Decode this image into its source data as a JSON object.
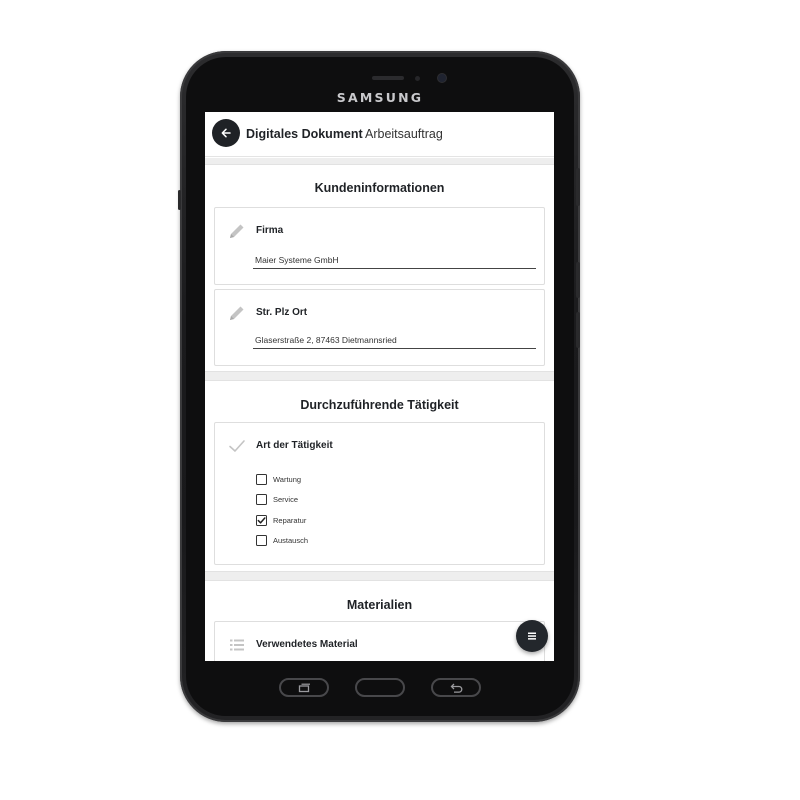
{
  "device": {
    "brand": "SAMSUNG"
  },
  "appbar": {
    "title": "Digitales Dokument",
    "subtitle": "Arbeitsauftrag"
  },
  "sections": {
    "customer": {
      "title": "Kundeninformationen",
      "company": {
        "label": "Firma",
        "value": "Maier Systeme GmbH"
      },
      "address": {
        "label": "Str. Plz Ort",
        "value": "Glaserstraße 2, 87463 Dietmannsried"
      }
    },
    "activity": {
      "title": "Durchzuführende Tätigkeit",
      "label": "Art der Tätigkeit",
      "options": [
        {
          "label": "Wartung",
          "checked": false
        },
        {
          "label": "Service",
          "checked": false
        },
        {
          "label": "Reparatur",
          "checked": true
        },
        {
          "label": "Austausch",
          "checked": false
        }
      ]
    },
    "materials": {
      "title": "Materialien",
      "label": "Verwendetes Material"
    }
  },
  "colors": {
    "accent": "#1f2226",
    "icon_grey": "#bdbdbd",
    "background": "#eeeeee"
  },
  "icons": {
    "back": "arrow-left-icon",
    "edit": "pencil-icon",
    "check": "check-icon",
    "list": "list-icon",
    "menu": "menu-icon",
    "recent": "recent-apps-icon",
    "return": "return-icon"
  }
}
